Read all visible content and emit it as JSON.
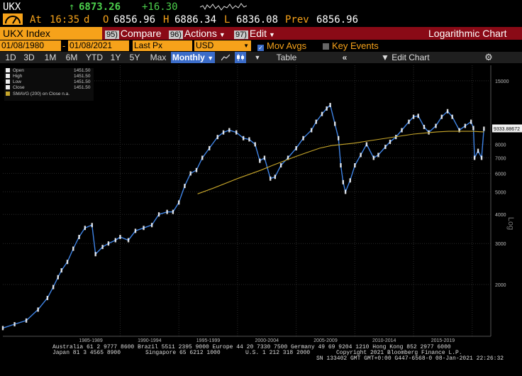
{
  "header": {
    "icon": "bloomberg-gauge-icon",
    "ticker": "UKX",
    "last_arrow": "↑",
    "last": "6873.26",
    "change": "+16.30",
    "at_label": "At",
    "time": "16:35",
    "d_label": "d",
    "open_label": "O",
    "open": "6856.96",
    "high_label": "H",
    "high": "6886.34",
    "low_label": "L",
    "low": "6836.08",
    "prev_label": "Prev",
    "prev": "6856.96"
  },
  "toolbar": {
    "security": "UKX Index",
    "compare_num": "95)",
    "compare": "Compare",
    "actions_num": "96)",
    "actions": "Actions",
    "edit_num": "97)",
    "edit": "Edit",
    "chart_title": "Logarithmic Chart"
  },
  "range": {
    "start": "01/08/1980",
    "end": "01/08/2021",
    "field": "Last Px",
    "currency": "USD",
    "mov_avgs": "Mov Avgs",
    "key_events": "Key Events"
  },
  "period_bar": {
    "items": [
      "1D",
      "3D",
      "1M",
      "6M",
      "YTD",
      "1Y",
      "5Y",
      "Max"
    ],
    "selected": "Monthly",
    "table": "Table",
    "edit_chart": "Edit Chart"
  },
  "legend": {
    "rows": [
      {
        "label": "Open",
        "value": "1451.50"
      },
      {
        "label": "High",
        "value": "1451.50"
      },
      {
        "label": "Low",
        "value": "1451.50"
      },
      {
        "label": "Close",
        "value": "1451.50"
      }
    ],
    "sma_label": "SMAVG (200)  on Close",
    "sma_value": "n.a."
  },
  "chart_data": {
    "type": "line",
    "yscale": "log",
    "ylabel": "Log",
    "ylim": [
      1250,
      17000
    ],
    "y_ticks": [
      2000,
      3000,
      4000,
      5000,
      6000,
      7000,
      8000,
      15000
    ],
    "y_tick_labels": [
      "2000",
      "3000",
      "4000",
      "5000",
      "6000",
      "7000",
      "8000",
      "15000"
    ],
    "x_period_labels": [
      "1985-1989",
      "1990-1994",
      "1995-1999",
      "2000-2004",
      "2005-2009",
      "2010-2014",
      "2015-2019"
    ],
    "xlim": [
      1980.0,
      2021.1
    ],
    "last_value_label": "9333.88672",
    "series": [
      {
        "name": "UKX Index",
        "color": "#3f84e6",
        "x": [
          1980.0,
          1981.0,
          1982.0,
          1983.0,
          1983.8,
          1984.3,
          1984.7,
          1985.0,
          1985.5,
          1986.0,
          1986.5,
          1987.0,
          1987.6,
          1987.9,
          1988.5,
          1989.0,
          1989.6,
          1990.0,
          1990.7,
          1991.3,
          1992.0,
          1992.7,
          1993.3,
          1994.0,
          1994.5,
          1995.0,
          1995.5,
          1996.0,
          1996.5,
          1997.0,
          1997.6,
          1998.3,
          1998.8,
          1999.3,
          1999.9,
          2000.5,
          2001.0,
          2001.5,
          2001.9,
          2002.3,
          2002.8,
          2003.2,
          2003.7,
          2004.3,
          2005.0,
          2005.6,
          2006.3,
          2006.7,
          2007.2,
          2007.6,
          2007.9,
          2008.3,
          2008.6,
          2008.8,
          2009.0,
          2009.2,
          2009.6,
          2010.0,
          2010.5,
          2011.0,
          2011.6,
          2012.0,
          2012.6,
          2013.0,
          2013.5,
          2014.0,
          2014.6,
          2015.0,
          2015.4,
          2015.9,
          2016.3,
          2016.9,
          2017.4,
          2017.9,
          2018.3,
          2018.9,
          2019.4,
          2019.9,
          2020.1,
          2020.2,
          2020.5,
          2020.8,
          2021.0
        ],
        "y": [
          1300,
          1350,
          1400,
          1560,
          1750,
          1950,
          2150,
          2300,
          2500,
          2850,
          3200,
          3500,
          3600,
          2700,
          2900,
          3000,
          3100,
          3200,
          3100,
          3400,
          3500,
          3600,
          4000,
          4100,
          4100,
          4500,
          5300,
          6000,
          6200,
          7000,
          7700,
          8600,
          9000,
          9200,
          9000,
          8500,
          8400,
          8000,
          6800,
          7000,
          5700,
          5800,
          6500,
          7000,
          7700,
          8500,
          9200,
          10000,
          10800,
          11400,
          11800,
          9800,
          8500,
          6500,
          5500,
          5000,
          5600,
          6500,
          7200,
          8000,
          7000,
          7200,
          7800,
          8200,
          8600,
          9200,
          10000,
          10500,
          10600,
          9500,
          9000,
          9600,
          10500,
          11100,
          10500,
          9200,
          9600,
          10000,
          9400,
          7000,
          7500,
          7000,
          9333
        ]
      },
      {
        "name": "SMAVG (200)  on Close",
        "color": "#c7a62a",
        "x": [
          1996.6,
          1998.0,
          2000.0,
          2002.0,
          2003.0,
          2004.0,
          2005.0,
          2006.0,
          2007.0,
          2008.0,
          2009.0,
          2010.0,
          2011.0,
          2012.0,
          2013.0,
          2014.0,
          2015.0,
          2016.0,
          2017.0,
          2018.0,
          2019.0,
          2020.0,
          2021.0
        ],
        "y": [
          4900,
          5200,
          5700,
          6200,
          6500,
          6800,
          7100,
          7400,
          7700,
          7900,
          8000,
          8100,
          8250,
          8400,
          8550,
          8700,
          8850,
          8950,
          9050,
          9100,
          9100,
          9100,
          9050
        ]
      }
    ]
  },
  "footer": {
    "line1": "Australia 61 2 9777 8600 Brazil 5511 2395 9000 Europe 44 20 7330 7500 Germany 49 69 9204 1210 Hong Kong 852 2977 6000",
    "line2a": "Japan 81 3 4565 8900",
    "line2b": "Singapore 65 6212 1000",
    "line2c": "U.S. 1 212 318 2000",
    "line2d": "Copyright 2021 Bloomberg Finance L.P.",
    "line3": "SN 133402 GMT  GMT+0:00 G447-6568-0 08-Jan-2021 22:26:32"
  },
  "colors": {
    "accent": "#f6a21a",
    "menu_bar": "#8a0a16",
    "price_up": "#4ccf4c",
    "series": "#3f84e6",
    "sma": "#c7a62a"
  }
}
